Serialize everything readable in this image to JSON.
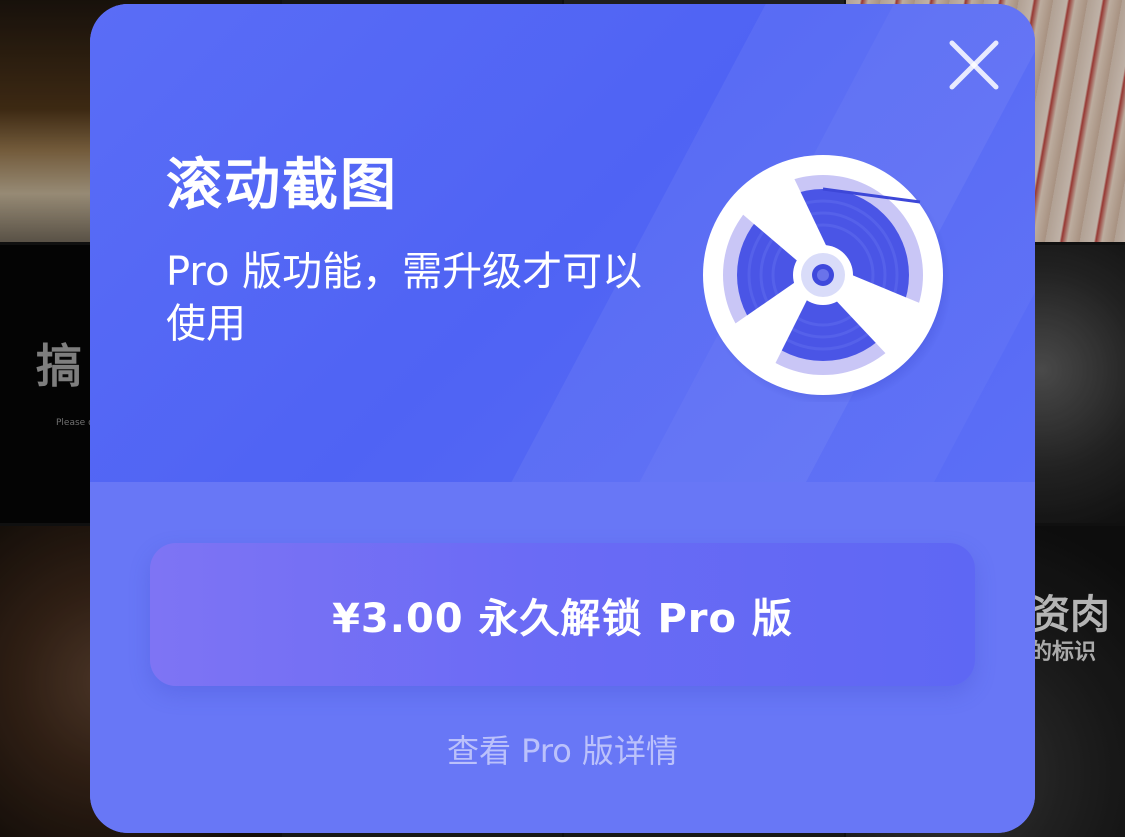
{
  "background": {
    "tile_text_big": "搞",
    "tile_text_small": "Please d",
    "tile_text_right_big": "资肉",
    "tile_text_right_small": "的标识"
  },
  "modal": {
    "title": "滚动截图",
    "subtitle": "Pro 版功能，需升级才可以使用",
    "close_icon": "close-icon",
    "illustration_icon": "film-reel-icon",
    "unlock_button_label": "¥3.00 永久解锁 Pro 版",
    "details_link_label": "查看 Pro 版详情"
  },
  "colors": {
    "modal_top": "#5266f4",
    "modal_bottom": "#6877f6",
    "button_start": "#7e74f4",
    "button_end": "#5e67f4",
    "text": "#ffffff"
  }
}
